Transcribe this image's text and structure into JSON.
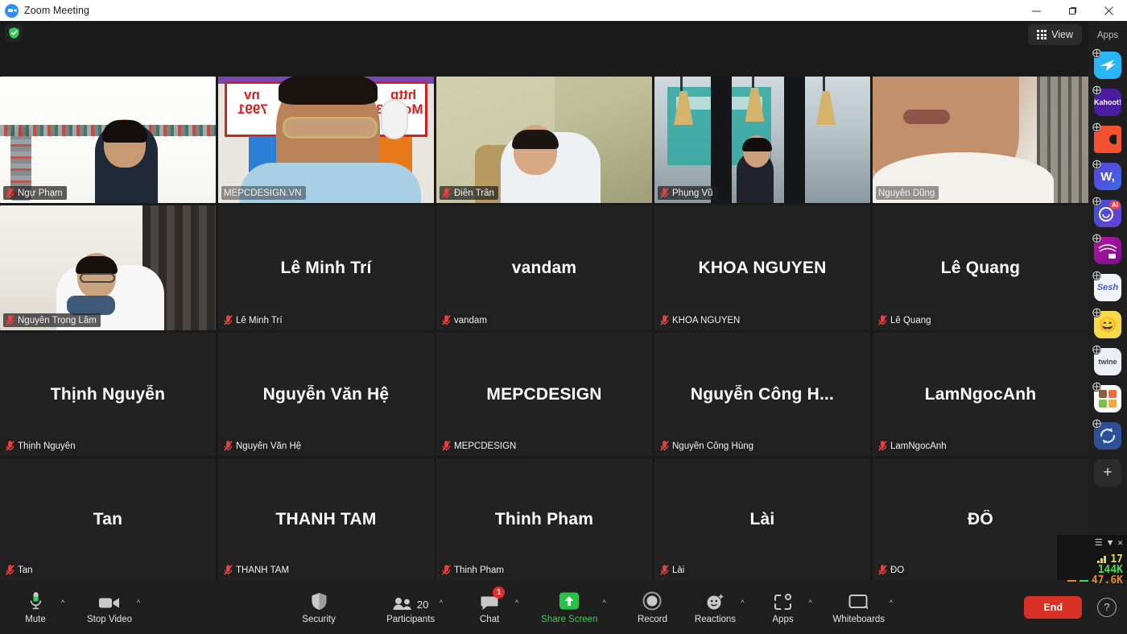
{
  "window": {
    "title": "Zoom Meeting",
    "logo_icon": "zoom-logo-icon",
    "minimize_label": "—",
    "maximize_label": "▢",
    "close_label": "✕"
  },
  "topbar": {
    "encryption_icon": "green-shield-check-icon",
    "view_label": "View",
    "view_icon": "grid-icon"
  },
  "gallery": {
    "rows": [
      [
        {
          "name": "Ngự Phạm",
          "video": true,
          "muted": true,
          "speaking": false,
          "cam": "cam1"
        },
        {
          "name": "MEPCDESIGN.VN",
          "video": true,
          "muted": false,
          "speaking": true,
          "cam": "cam2"
        },
        {
          "name": "Điền Trần",
          "video": true,
          "muted": true,
          "speaking": false,
          "cam": "cam3"
        },
        {
          "name": "Phụng Vũ",
          "video": true,
          "muted": true,
          "speaking": false,
          "cam": "cam4"
        },
        {
          "name": "Nguyễn Dũng",
          "video": true,
          "muted": false,
          "speaking": false,
          "cam": "cam5"
        }
      ],
      [
        {
          "name": "Nguyễn Trọng Lâm",
          "video": true,
          "muted": true,
          "speaking": false,
          "cam": "cam6"
        },
        {
          "name": "Lê Minh Trí",
          "display": "Lê Minh Trí",
          "video": false,
          "muted": true,
          "speaking": false
        },
        {
          "name": "vandam",
          "display": "vandam",
          "video": false,
          "muted": true,
          "speaking": false
        },
        {
          "name": "KHOA NGUYEN",
          "display": "KHOA NGUYEN",
          "video": false,
          "muted": true,
          "speaking": false
        },
        {
          "name": "Lê Quang",
          "display": "Lê Quang",
          "video": false,
          "muted": true,
          "speaking": false
        }
      ],
      [
        {
          "name": "Thịnh Nguyễn",
          "display": "Thịnh Nguyễn",
          "video": false,
          "muted": true,
          "speaking": false
        },
        {
          "name": "Nguyễn Văn Hệ",
          "display": "Nguyễn Văn Hệ",
          "video": false,
          "muted": true,
          "speaking": false
        },
        {
          "name": "MEPCDESIGN",
          "display": "MEPCDESIGN",
          "video": false,
          "muted": true,
          "speaking": false
        },
        {
          "name": "Nguyễn Công Hùng",
          "display": "Nguyễn Công H...",
          "video": false,
          "muted": true,
          "speaking": false
        },
        {
          "name": "LamNgocAnh",
          "display": "LamNgocAnh",
          "video": false,
          "muted": true,
          "speaking": false
        }
      ],
      [
        {
          "name": "Tan",
          "display": "Tan",
          "video": false,
          "muted": true,
          "speaking": false
        },
        {
          "name": "THANH TAM",
          "display": "THANH TAM",
          "video": false,
          "muted": true,
          "speaking": false
        },
        {
          "name": "Thinh Pham",
          "display": "Thinh Pham",
          "video": false,
          "muted": true,
          "speaking": false
        },
        {
          "name": "Lài",
          "display": "Lài",
          "video": false,
          "muted": true,
          "speaking": false
        },
        {
          "name": "ĐÔ",
          "display": "ĐÔ",
          "video": false,
          "muted": true,
          "speaking": false
        }
      ]
    ]
  },
  "apps_rail": {
    "title": "Apps",
    "items": [
      {
        "icon": "plane-app-icon",
        "label": "",
        "bg": "#29b6f6",
        "fg": "#ffffff"
      },
      {
        "icon": "kahoot-app-icon",
        "label": "Kahoot!",
        "bg": "#4b1c9e",
        "fg": "#ffffff"
      },
      {
        "icon": "puzzle-app-icon",
        "label": "",
        "bg": "#f4522e",
        "fg": "#ffffff"
      },
      {
        "icon": "wordly-app-icon",
        "label": "W,",
        "bg": "#4e3fd9",
        "fg": "#ffffff"
      },
      {
        "icon": "ai-companion-app-icon",
        "label": "AI",
        "bg": "#3b52d4",
        "fg": "#ffffff"
      },
      {
        "icon": "video-magenta-app-icon",
        "label": "",
        "bg": "#a3159c",
        "fg": "#ffffff"
      },
      {
        "icon": "sesh-app-icon",
        "label": "Sesh",
        "bg": "#f2f3f8",
        "fg": "#3f5fd0"
      },
      {
        "icon": "emoji-app-icon",
        "label": "",
        "bg": "#f7d948",
        "fg": "#1d1d1d"
      },
      {
        "icon": "twine-app-icon",
        "label": "twine",
        "bg": "#eceef6",
        "fg": "#3a3f55"
      },
      {
        "icon": "squares-app-icon",
        "label": "",
        "bg": "#ffffff",
        "fg": "#333333"
      },
      {
        "icon": "sync-app-icon",
        "label": "",
        "bg": "#2c4f96",
        "fg": "#ffffff"
      }
    ],
    "add_label": "+",
    "add_icon": "add-app-icon"
  },
  "network_stats": {
    "menu_icon": "hamburger-icon",
    "collapse_icon": "chevron-down-icon",
    "close_icon": "close-icon",
    "latency": "17",
    "download": "144K",
    "upload": "47.6K",
    "latency_color": "#e7d94a",
    "download_color": "#45d85f",
    "upload_color": "#e08a2a"
  },
  "toolbar": {
    "mute_label": "Mute",
    "mute_icon": "microphone-icon",
    "video_label": "Stop Video",
    "video_icon": "video-camera-icon",
    "security_label": "Security",
    "security_icon": "shield-icon",
    "participants_label": "Participants",
    "participants_icon": "people-icon",
    "participants_count": "20",
    "chat_label": "Chat",
    "chat_icon": "chat-bubble-icon",
    "chat_badge": "1",
    "share_label": "Share Screen",
    "share_icon": "share-screen-up-arrow-icon",
    "record_label": "Record",
    "record_icon": "record-circle-icon",
    "reactions_label": "Reactions",
    "reactions_icon": "smiley-sparkle-icon",
    "apps_label": "Apps",
    "apps_icon": "apps-bracket-icon",
    "whiteboards_label": "Whiteboards",
    "whiteboards_icon": "whiteboard-icon",
    "end_label": "End",
    "help_label": "?",
    "help_icon": "help-circle-icon",
    "chevron": "^",
    "share_color": "#46c856",
    "end_color": "#d93025"
  }
}
